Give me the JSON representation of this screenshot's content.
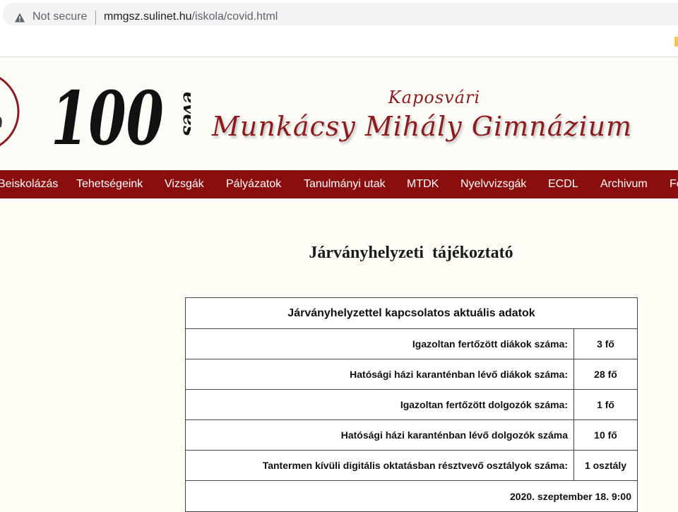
{
  "browser": {
    "security_label": "Not secure",
    "url_host": "mmgsz.sulinet.hu",
    "url_path": "/iskola/covid.html",
    "icons": {
      "security": "warning-triangle-icon"
    }
  },
  "header": {
    "anniversary_number": "100",
    "anniversary_word": "éves",
    "town": "Kaposvári",
    "school_name": "Munkácsy Mihály Gimnázium",
    "brand_color": "#8b1b1e"
  },
  "nav": {
    "color": "#8b0e0e",
    "items": [
      {
        "label": "Beiskolázás"
      },
      {
        "label": "Tehetségeink"
      },
      {
        "label": "Vizsgák"
      },
      {
        "label": "Pályázatok"
      },
      {
        "label": "Tanulmányi utak"
      },
      {
        "label": "MTDK"
      },
      {
        "label": "Nyelvvizsgák"
      },
      {
        "label": "ECDL"
      },
      {
        "label": "Archivum"
      },
      {
        "label": "Fő"
      }
    ]
  },
  "main": {
    "title": "Járványhelyzeti  tájékoztató",
    "table": {
      "caption": "Járványhelyzettel kapcsolatos aktuális adatok",
      "rows": [
        {
          "label": "Igazoltan fertőzött diákok száma:",
          "value": "3 fő"
        },
        {
          "label": "Hatósági házi karanténban lévő diákok száma:",
          "value": "28 fő"
        },
        {
          "label": "Igazoltan fertőzött dolgozók száma:",
          "value": "1 fő"
        },
        {
          "label": "Hatósági házi karanténban lévő dolgozók száma",
          "value": "10 fő"
        },
        {
          "label": "Tantermen kívüli digitális oktatásban résztvevő osztályok száma:",
          "value": "1 osztály"
        }
      ],
      "date": "2020. szeptember 18. 9:00"
    }
  }
}
